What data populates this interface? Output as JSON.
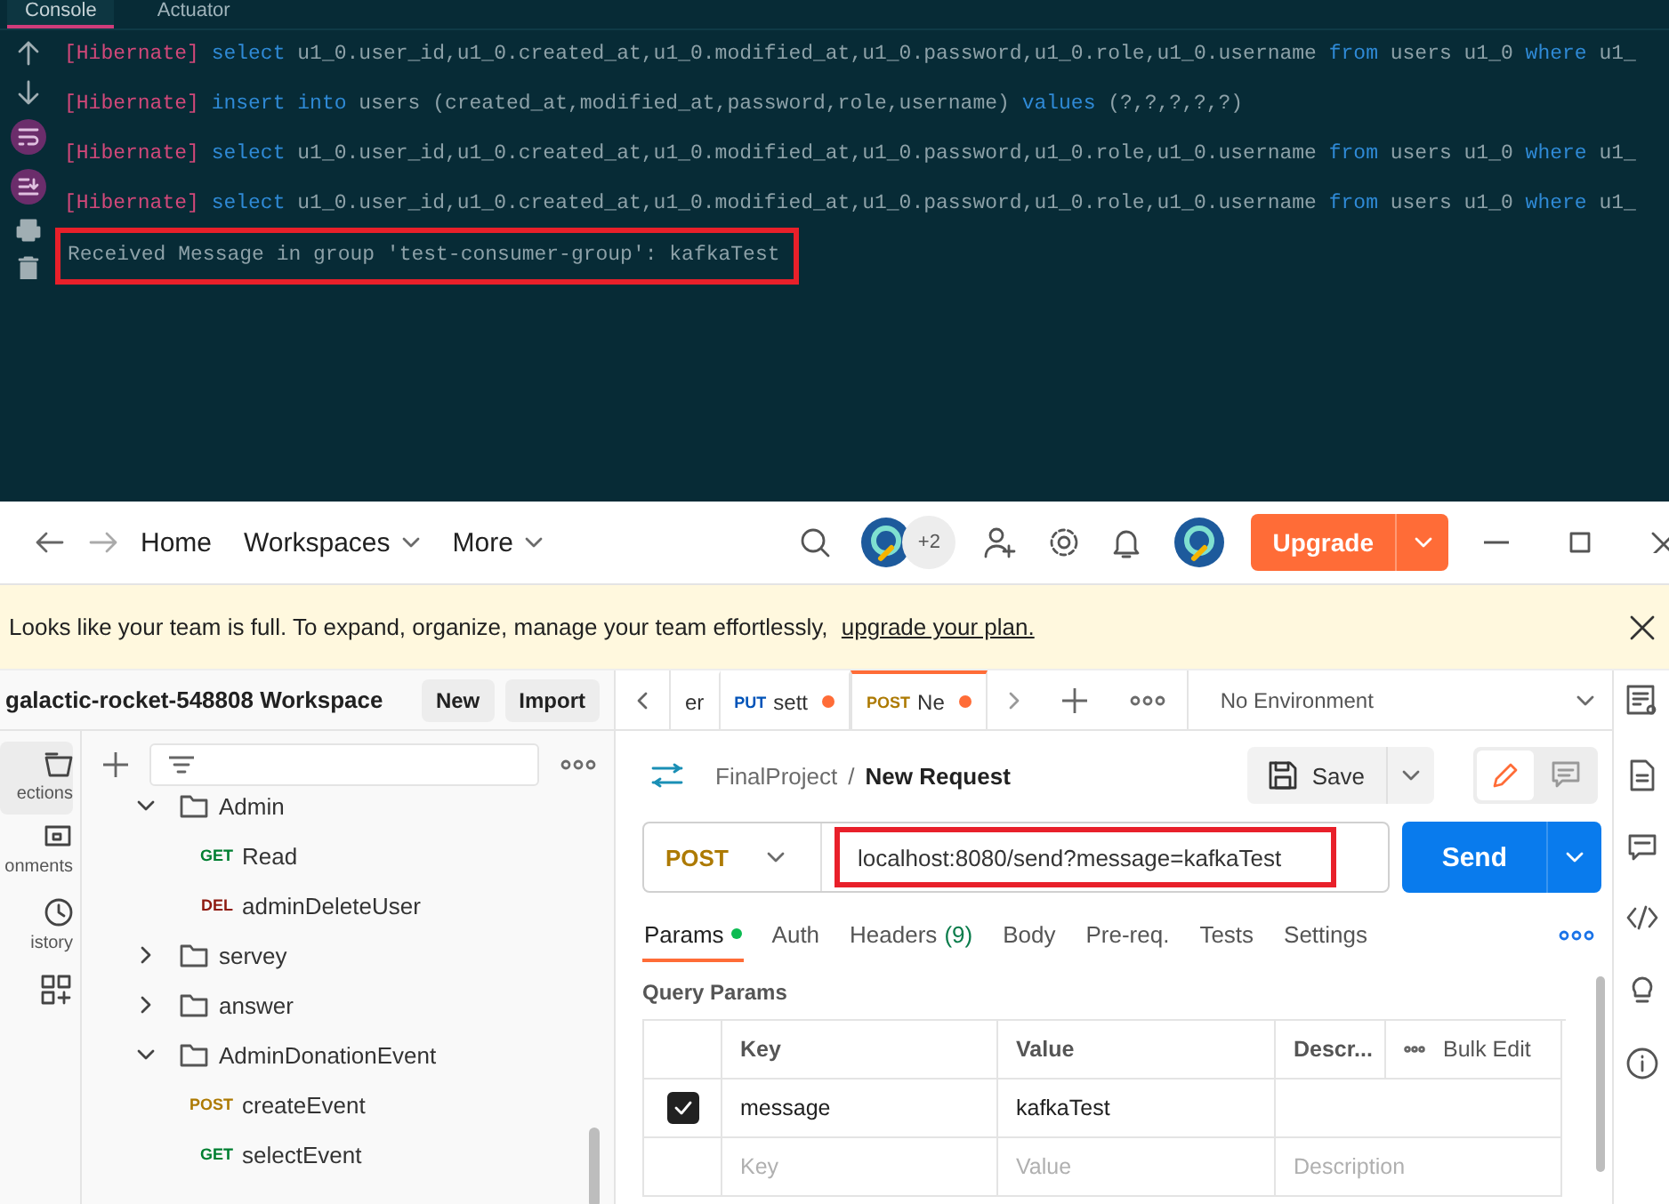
{
  "console": {
    "tabs": [
      {
        "label": "Console",
        "selected": true
      },
      {
        "label": "Actuator",
        "selected": false
      }
    ],
    "lines": [
      {
        "highlighted": false,
        "segments": [
          {
            "kind": "tag",
            "text": "[Hibernate]"
          },
          {
            "kind": "keyword",
            "text": "select"
          },
          {
            "kind": "plain",
            "text": "u1_0.user_id,u1_0.created_at,u1_0.modified_at,u1_0.password,u1_0.role,u1_0.username"
          },
          {
            "kind": "keyword",
            "text": "from"
          },
          {
            "kind": "plain",
            "text": "users u1_0"
          },
          {
            "kind": "keyword",
            "text": "where"
          },
          {
            "kind": "plain",
            "text": "u1_"
          }
        ]
      },
      {
        "highlighted": false,
        "segments": [
          {
            "kind": "tag",
            "text": "[Hibernate]"
          },
          {
            "kind": "keyword",
            "text": "insert into"
          },
          {
            "kind": "plain",
            "text": "users (created_at,modified_at,password,role,username)"
          },
          {
            "kind": "keyword",
            "text": "values"
          },
          {
            "kind": "plain",
            "text": "(?,?,?,?,?)"
          }
        ]
      },
      {
        "highlighted": false,
        "segments": [
          {
            "kind": "tag",
            "text": "[Hibernate]"
          },
          {
            "kind": "keyword",
            "text": "select"
          },
          {
            "kind": "plain",
            "text": "u1_0.user_id,u1_0.created_at,u1_0.modified_at,u1_0.password,u1_0.role,u1_0.username"
          },
          {
            "kind": "keyword",
            "text": "from"
          },
          {
            "kind": "plain",
            "text": "users u1_0"
          },
          {
            "kind": "keyword",
            "text": "where"
          },
          {
            "kind": "plain",
            "text": "u1_"
          }
        ]
      },
      {
        "highlighted": false,
        "segments": [
          {
            "kind": "tag",
            "text": "[Hibernate]"
          },
          {
            "kind": "keyword",
            "text": "select"
          },
          {
            "kind": "plain",
            "text": "u1_0.user_id,u1_0.created_at,u1_0.modified_at,u1_0.password,u1_0.role,u1_0.username"
          },
          {
            "kind": "keyword",
            "text": "from"
          },
          {
            "kind": "plain",
            "text": "users u1_0"
          },
          {
            "kind": "keyword",
            "text": "where"
          },
          {
            "kind": "plain",
            "text": "u1_"
          }
        ]
      },
      {
        "highlighted": true,
        "segments": [
          {
            "kind": "plain",
            "text": "Received Message in group 'test-consumer-group': kafkaTest"
          }
        ]
      }
    ]
  },
  "header": {
    "nav": [
      {
        "label": "Home",
        "dropdown": false
      },
      {
        "label": "Workspaces",
        "dropdown": true
      },
      {
        "label": "More",
        "dropdown": true
      }
    ],
    "collaborators_count": "+2",
    "upgrade": "Upgrade"
  },
  "banner": {
    "text": "Looks like your team is full. To expand, organize, manage your team effortlessly,",
    "link": "upgrade your plan."
  },
  "workspace": {
    "title": "galactic-rocket-548808 Workspace",
    "buttons": [
      "New",
      "Import"
    ]
  },
  "rail": [
    {
      "kind": "collections",
      "label": "ections",
      "selected": true
    },
    {
      "kind": "environments",
      "label": "onments",
      "selected": false
    },
    {
      "kind": "history",
      "label": "istory",
      "selected": false
    },
    {
      "kind": "apps",
      "selected": false
    }
  ],
  "tree": [
    {
      "kind": "folder",
      "name": "Admin",
      "expanded": true,
      "children": [
        {
          "kind": "request",
          "method": "GET",
          "color": "#007f31",
          "name": "Read"
        },
        {
          "kind": "request",
          "method": "DEL",
          "color": "#8e1a10",
          "name": "adminDeleteUser"
        }
      ]
    },
    {
      "kind": "folder",
      "name": "servey",
      "expanded": false
    },
    {
      "kind": "folder",
      "name": "answer",
      "expanded": false
    },
    {
      "kind": "folder",
      "name": "AdminDonationEvent",
      "expanded": true,
      "children": [
        {
          "kind": "request",
          "method": "POST",
          "color": "#ad7a03",
          "name": "createEvent"
        },
        {
          "kind": "request",
          "method": "GET",
          "color": "#007f31",
          "name": "selectEvent"
        }
      ]
    }
  ],
  "request_tabs": [
    {
      "label": "er",
      "selected": false,
      "unsaved": false
    },
    {
      "method": "PUT",
      "color": "#0053b8",
      "label": "sett",
      "selected": false,
      "unsaved": true
    },
    {
      "method": "POST",
      "color": "#ad7a03",
      "label": "Ne",
      "selected": true,
      "unsaved": true
    }
  ],
  "environment": "No Environment",
  "breadcrumb": {
    "collection": "FinalProject",
    "separator": "/",
    "request": "New Request"
  },
  "save": "Save",
  "request": {
    "method": "POST",
    "color": "#ad7a03",
    "url": "localhost:8080/send?message=kafkaTest",
    "highlighted": true,
    "send": "Send"
  },
  "sections": [
    {
      "label": "Params",
      "selected": true,
      "dot": true
    },
    {
      "label": "Auth",
      "selected": false,
      "dot": false
    },
    {
      "label": "Headers",
      "count": "(9)",
      "selected": false,
      "dot": false
    },
    {
      "label": "Body",
      "selected": false,
      "dot": false
    },
    {
      "label": "Pre-req.",
      "selected": false,
      "dot": false
    },
    {
      "label": "Tests",
      "selected": false,
      "dot": false
    },
    {
      "label": "Settings",
      "selected": false,
      "dot": false
    }
  ],
  "query_params": {
    "title": "Query Params",
    "columns": [
      "Key",
      "Value",
      "Descr..."
    ],
    "bulk_edit": "Bulk Edit",
    "rows": [
      {
        "checked": true,
        "key": "message",
        "value": "kafkaTest"
      }
    ],
    "placeholders": {
      "key": "Key",
      "value": "Value",
      "description": "Description"
    }
  }
}
